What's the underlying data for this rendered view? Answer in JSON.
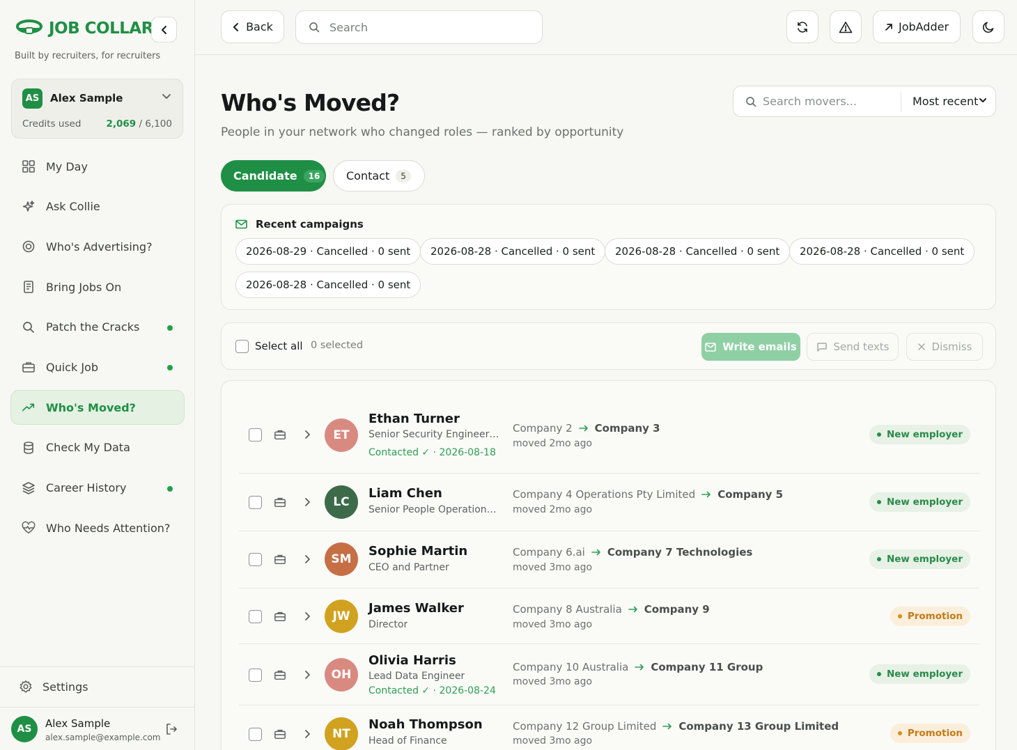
{
  "brand": {
    "name": "JOB COLLAR",
    "tagline": "Built by recruiters, for recruiters"
  },
  "account": {
    "initials": "AS",
    "name": "Alex Sample",
    "credits_label": "Credits used",
    "credits_used": "2,069",
    "credits_total": "/ 6,100"
  },
  "nav": [
    {
      "label": "My Day",
      "icon": "grid-icon",
      "dot": false,
      "active": false
    },
    {
      "label": "Ask Collie",
      "icon": "sparkle-icon",
      "dot": false,
      "active": false
    },
    {
      "label": "Who's Advertising?",
      "icon": "target-icon",
      "dot": false,
      "active": false
    },
    {
      "label": "Bring Jobs On",
      "icon": "document-icon",
      "dot": false,
      "active": false
    },
    {
      "label": "Patch the Cracks",
      "icon": "search-icon",
      "dot": true,
      "active": false
    },
    {
      "label": "Quick Job",
      "icon": "briefcase-icon",
      "dot": true,
      "active": false
    },
    {
      "label": "Who's Moved?",
      "icon": "trending-up-icon",
      "dot": false,
      "active": true
    },
    {
      "label": "Check My Data",
      "icon": "database-icon",
      "dot": false,
      "active": false
    },
    {
      "label": "Career History",
      "icon": "layers-icon",
      "dot": true,
      "active": false
    },
    {
      "label": "Who Needs Attention?",
      "icon": "heart-pulse-icon",
      "dot": false,
      "active": false
    }
  ],
  "settings": {
    "label": "Settings"
  },
  "user": {
    "initials": "AS",
    "name": "Alex Sample",
    "email": "alex.sample@example.com"
  },
  "topbar": {
    "back_label": "Back",
    "search_placeholder": "Search",
    "jobadder_label": "JobAdder"
  },
  "page": {
    "title": "Who's Moved?",
    "subtitle": "People in your network who changed roles — ranked by opportunity",
    "movers_search_placeholder": "Search movers...",
    "sort_label": "Most recent"
  },
  "tabs": [
    {
      "label": "Candidate",
      "count": "16",
      "active": true
    },
    {
      "label": "Contact",
      "count": "5",
      "active": false
    }
  ],
  "campaigns": {
    "heading": "Recent campaigns",
    "items": [
      "2026-08-29 · Cancelled · 0 sent",
      "2026-08-28 · Cancelled · 0 sent",
      "2026-08-28 · Cancelled · 0 sent",
      "2026-08-28 · Cancelled · 0 sent",
      "2026-08-28 · Cancelled · 0 sent"
    ]
  },
  "toolbar": {
    "select_all": "Select all",
    "selected": "0 selected",
    "write_emails": "Write emails",
    "send_texts": "Send texts",
    "dismiss": "Dismiss"
  },
  "movers": [
    {
      "initials": "ET",
      "name": "Ethan Turner",
      "role": "Senior Security Engineer (A...",
      "contacted": "Contacted ✓ · 2026-08-18",
      "from": "Company 2",
      "to": "Company 3",
      "ago": "moved 2mo ago",
      "badge": "New employer",
      "badge_type": "new",
      "avatar_color": "#d98a80"
    },
    {
      "initials": "LC",
      "name": "Liam Chen",
      "role": "Senior People Operations M...",
      "contacted": "",
      "from": "Company 4 Operations Pty Limited",
      "to": "Company 5",
      "ago": "moved 2mo ago",
      "badge": "New employer",
      "badge_type": "new",
      "avatar_color": "#3d6b4a"
    },
    {
      "initials": "SM",
      "name": "Sophie Martin",
      "role": "CEO and Partner",
      "contacted": "",
      "from": "Company 6.ai",
      "to": "Company 7 Technologies",
      "ago": "moved 3mo ago",
      "badge": "New employer",
      "badge_type": "new",
      "avatar_color": "#c66f45"
    },
    {
      "initials": "JW",
      "name": "James Walker",
      "role": "Director",
      "contacted": "",
      "from": "Company 8 Australia",
      "to": "Company 9",
      "ago": "moved 3mo ago",
      "badge": "Promotion",
      "badge_type": "promo",
      "avatar_color": "#d1a21f"
    },
    {
      "initials": "OH",
      "name": "Olivia Harris",
      "role": "Lead Data Engineer",
      "contacted": "Contacted ✓ · 2026-08-24",
      "from": "Company 10 Australia",
      "to": "Company 11 Group",
      "ago": "moved 3mo ago",
      "badge": "New employer",
      "badge_type": "new",
      "avatar_color": "#d98a80"
    },
    {
      "initials": "NT",
      "name": "Noah Thompson",
      "role": "Head of Finance",
      "contacted": "",
      "from": "Company 12 Group Limited",
      "to": "Company 13 Group Limited",
      "ago": "moved 3mo ago",
      "badge": "Promotion",
      "badge_type": "promo",
      "avatar_color": "#d1a21f"
    }
  ],
  "colors": {
    "accent": "#1f8f45",
    "promotion": "#c37a17"
  }
}
